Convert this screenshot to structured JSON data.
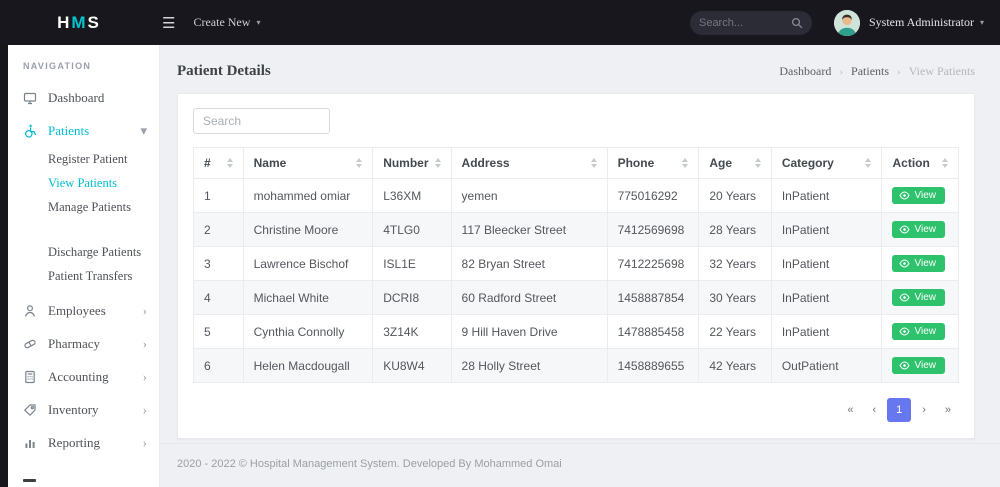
{
  "navbar": {
    "logo": {
      "h": "H",
      "m": "M",
      "s": "S"
    },
    "create_new": "Create New",
    "search_placeholder": "Search...",
    "user_name": "System Administrator"
  },
  "icons": {
    "menu": "☰",
    "caret_down": "▾",
    "chevron_right": "›",
    "chevron_down": "▾",
    "breadcrumb_separator": "›"
  },
  "sidebar": {
    "section_label": "NAVIGATION",
    "items": [
      {
        "label": "Dashboard"
      },
      {
        "label": "Patients"
      },
      {
        "label": "Employees"
      },
      {
        "label": "Pharmacy"
      },
      {
        "label": "Accounting"
      },
      {
        "label": "Inventory"
      },
      {
        "label": "Reporting"
      }
    ],
    "patients_submenu": [
      {
        "label": "Register Patient"
      },
      {
        "label": "View Patients"
      },
      {
        "label": "Manage Patients"
      },
      {
        "label": "Discharge Patients"
      },
      {
        "label": "Patient Transfers"
      }
    ]
  },
  "page": {
    "title": "Patient Details",
    "breadcrumb": [
      {
        "label": "Dashboard"
      },
      {
        "label": "Patients"
      },
      {
        "label": "View Patients"
      }
    ]
  },
  "table": {
    "search_placeholder": "Search",
    "columns": [
      "#",
      "Name",
      "Number",
      "Address",
      "Phone",
      "Age",
      "Category",
      "Action"
    ],
    "rows": [
      {
        "num": "1",
        "name": "mohammed omiar",
        "number": "L36XM",
        "address": "yemen",
        "phone": "775016292",
        "age": "20 Years",
        "category": "InPatient"
      },
      {
        "num": "2",
        "name": "Christine Moore",
        "number": "4TLG0",
        "address": "117 Bleecker Street",
        "phone": "7412569698",
        "age": "28 Years",
        "category": "InPatient"
      },
      {
        "num": "3",
        "name": "Lawrence Bischof",
        "number": "ISL1E",
        "address": "82 Bryan Street",
        "phone": "7412225698",
        "age": "32 Years",
        "category": "InPatient"
      },
      {
        "num": "4",
        "name": "Michael White",
        "number": "DCRI8",
        "address": "60 Radford Street",
        "phone": "1458887854",
        "age": "30 Years",
        "category": "InPatient"
      },
      {
        "num": "5",
        "name": "Cynthia Connolly",
        "number": "3Z14K",
        "address": "9 Hill Haven Drive",
        "phone": "1478885458",
        "age": "22 Years",
        "category": "InPatient"
      },
      {
        "num": "6",
        "name": "Helen Macdougall",
        "number": "KU8W4",
        "address": "28 Holly Street",
        "phone": "1458889655",
        "age": "42 Years",
        "category": "OutPatient"
      }
    ],
    "action_label": "View",
    "pagination": {
      "first": "«",
      "prev": "‹",
      "current": "1",
      "next": "›",
      "last": "»"
    }
  },
  "footer": {
    "text": "2020 - 2022 © Hospital Management System. Developed By Mohammed Omai"
  },
  "colors": {
    "accent": "#00bcd4",
    "primary": "#6777ef",
    "success": "#2dc26b",
    "navbar_bg": "#17171d"
  }
}
